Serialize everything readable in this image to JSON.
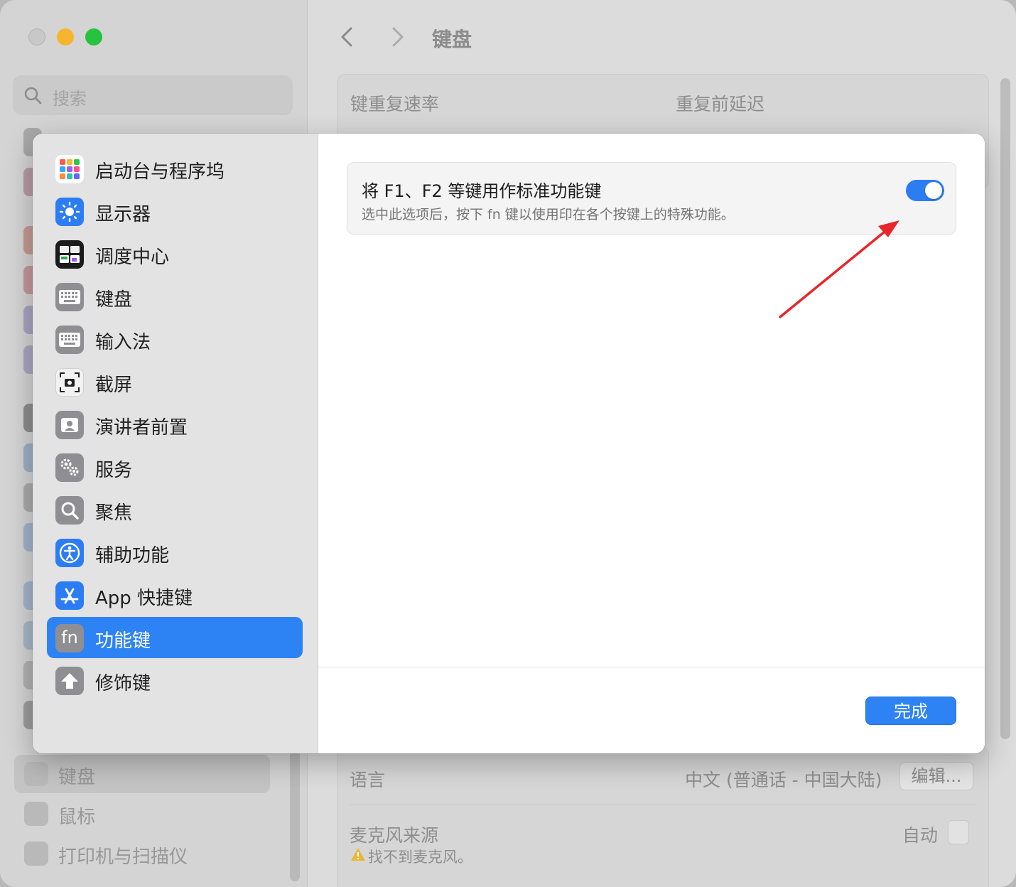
{
  "window": {
    "title": "键盘",
    "search_placeholder": "搜索",
    "background_sidebar": [
      {
        "label": "键盘",
        "selected": true
      },
      {
        "label": "鼠标"
      },
      {
        "label": "打印机与扫描仪"
      }
    ],
    "background_main": {
      "key_repeat_rate": "键重复速率",
      "delay_until_repeat": "重复前延迟",
      "language_label": "语言",
      "language_value": "中文 (普通话 - 中国大陆)",
      "edit_button": "编辑...",
      "mic_label": "麦克风来源",
      "mic_value": "自动",
      "mic_warning": "找不到麦克风。"
    }
  },
  "sheet": {
    "sidebar_items": [
      {
        "label": "启动台与程序坞",
        "icon": "launchpad-icon"
      },
      {
        "label": "显示器",
        "icon": "display-icon"
      },
      {
        "label": "调度中心",
        "icon": "mission-control-icon"
      },
      {
        "label": "键盘",
        "icon": "keyboard-icon"
      },
      {
        "label": "输入法",
        "icon": "input-method-icon"
      },
      {
        "label": "截屏",
        "icon": "screenshot-icon"
      },
      {
        "label": "演讲者前置",
        "icon": "presenter-icon"
      },
      {
        "label": "服务",
        "icon": "services-icon"
      },
      {
        "label": "聚焦",
        "icon": "spotlight-icon"
      },
      {
        "label": "辅助功能",
        "icon": "accessibility-icon"
      },
      {
        "label": "App 快捷键",
        "icon": "app-shortcuts-icon"
      },
      {
        "label": "功能键",
        "icon": "fn-icon",
        "active": true
      },
      {
        "label": "修饰键",
        "icon": "modifier-keys-icon"
      }
    ],
    "fn_icon_text": "fn",
    "option": {
      "title": "将 F1、F2 等键用作标准功能键",
      "description": "选中此选项后，按下 fn 键以使用印在各个按键上的特殊功能。",
      "enabled": true
    },
    "done_button": "完成"
  },
  "colors": {
    "accent": "#2e83f4",
    "annotation_arrow": "#e8262b"
  }
}
